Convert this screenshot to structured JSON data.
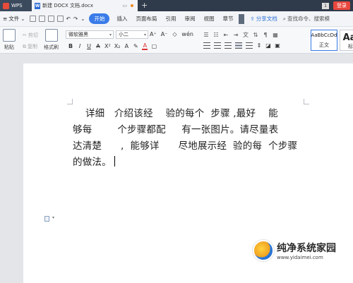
{
  "titlebar": {
    "app_tab": "WPS",
    "doc_tab": "新建 DOCX 文档.docx",
    "new_tab_symbol": "+",
    "badge": "1",
    "login_label": "登录"
  },
  "menubar": {
    "file_label": "文件",
    "start_label": "开始",
    "items": [
      "插入",
      "页面布局",
      "引用",
      "审阅",
      "视图",
      "章节"
    ],
    "share_label": "分享文档",
    "search_label": "查找命令、搜索模"
  },
  "ribbon": {
    "paste_label": "粘贴",
    "cut_label": "剪切",
    "copy_label": "复制",
    "format_painter_label": "格式刷",
    "font_name": "微软雅黑",
    "font_size": "小二",
    "format_glyphs": [
      "B",
      "I",
      "U",
      "A",
      "X²",
      "X₂",
      "A",
      "A"
    ],
    "style_normal_sample": "AaBbCcDd",
    "style_normal_label": "正文",
    "style_title_sample": "AaB",
    "style_title_label": "标题"
  },
  "document": {
    "lines": [
      "    详细   介绍该经    验的每个  步骤 ,最好    能",
      "够每        个步骤都配     有一张图片。请尽量表",
      "达清楚      ,  能够详      尽地展示经  验的每  个步骤",
      "的做法。"
    ]
  },
  "watermark": {
    "title": "纯净系统家园",
    "url": "www.yidaimei.com"
  },
  "colors": {
    "titlebar_bg": "#2f3a4a",
    "accent_blue": "#3a7be8",
    "login_red": "#e8473d",
    "page_bg": "#ffffff"
  }
}
